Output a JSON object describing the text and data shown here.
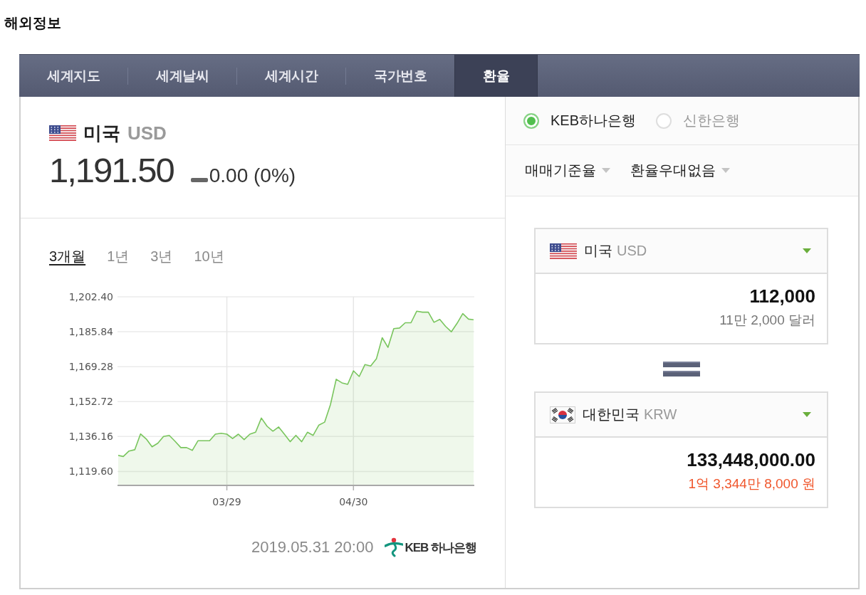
{
  "page": {
    "title": "해외정보"
  },
  "tabs": [
    {
      "label": "세계지도",
      "selected": false
    },
    {
      "label": "세계날씨",
      "selected": false
    },
    {
      "label": "세계시간",
      "selected": false
    },
    {
      "label": "국가번호",
      "selected": false
    },
    {
      "label": "환율",
      "selected": true
    }
  ],
  "rate_panel": {
    "country": "미국",
    "currency": "USD",
    "rate": "1,191.50",
    "change": {
      "kind": "flat",
      "text": "0.00 (0%)"
    }
  },
  "chart_panel": {
    "periods": [
      {
        "label": "3개월",
        "selected": true
      },
      {
        "label": "1년",
        "selected": false
      },
      {
        "label": "3년",
        "selected": false
      },
      {
        "label": "10년",
        "selected": false
      }
    ],
    "chart_data": {
      "type": "area",
      "categories": [
        null,
        null,
        null,
        null,
        null,
        null,
        null,
        null,
        null,
        null,
        null,
        null,
        null,
        null,
        null,
        null,
        null,
        null,
        null,
        "03/29",
        null,
        null,
        null,
        null,
        null,
        null,
        null,
        null,
        null,
        null,
        null,
        null,
        null,
        null,
        null,
        null,
        null,
        null,
        null,
        null,
        null,
        "04/30",
        null,
        null,
        null,
        null,
        null,
        null,
        null,
        null,
        null,
        null,
        null,
        null,
        null,
        null,
        null,
        null,
        null,
        null,
        null,
        null,
        null
      ],
      "values": [
        1127.3,
        1126.7,
        1129.3,
        1129.9,
        1137.4,
        1135.0,
        1131.3,
        1133.0,
        1136.2,
        1136.7,
        1133.9,
        1130.9,
        1130.9,
        1129.6,
        1134.2,
        1134.2,
        1134.2,
        1137.3,
        1137.7,
        1137.3,
        1135.2,
        1137.3,
        1134.7,
        1137.3,
        1138.2,
        1144.9,
        1141.0,
        1138.7,
        1140.7,
        1137.3,
        1133.7,
        1136.7,
        1133.7,
        1138.2,
        1136.7,
        1141.6,
        1143.0,
        1151.3,
        1163.3,
        1161.6,
        1160.9,
        1167.3,
        1164.6,
        1170.3,
        1169.6,
        1173.1,
        1183.0,
        1178.4,
        1187.3,
        1187.6,
        1190.1,
        1190.1,
        1195.6,
        1195.1,
        1195.1,
        1190.3,
        1191.7,
        1188.4,
        1185.8,
        1189.8,
        1194.4,
        1191.8,
        1191.5
      ],
      "color": "#79c55d",
      "ylim": [
        1113.0,
        1202.4
      ],
      "yticks": [
        {
          "value": 1119.6,
          "label": "1,119.60"
        },
        {
          "value": 1136.16,
          "label": "1,136.16"
        },
        {
          "value": 1152.72,
          "label": "1,152.72"
        },
        {
          "value": 1169.28,
          "label": "1,169.28"
        },
        {
          "value": 1185.84,
          "label": "1,185.84"
        },
        {
          "value": 1202.4,
          "label": "1,202.40"
        }
      ],
      "grid": true
    },
    "timestamp": "2019.05.31 20:00",
    "source_logo": "KEB 하나은행"
  },
  "banks": [
    {
      "label": "KEB하나은행",
      "selected": true
    },
    {
      "label": "신한은행",
      "selected": false
    }
  ],
  "filters": [
    "매매기준율",
    "환율우대없음"
  ],
  "converters": [
    {
      "kind": "input",
      "country": "미국",
      "currency": "USD",
      "amount": "112,000",
      "amount_words": "11만 2,000 달러"
    },
    {
      "kind": "result",
      "country": "대한민국",
      "currency": "KRW",
      "amount": "133,448,000.00",
      "amount_words": "1억 3,344만 8,000 원"
    }
  ]
}
